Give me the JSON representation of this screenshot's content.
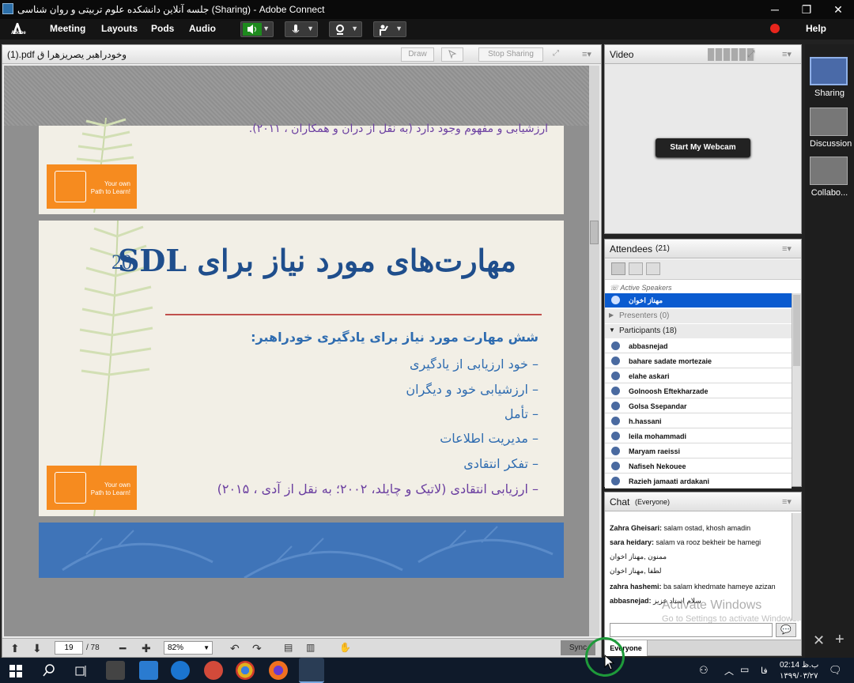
{
  "window": {
    "title": "جلسه آنلاین دانشکده علوم تربیتی و روان شناسی (Sharing) - Adobe Connect",
    "minimize": "─",
    "restore": "❐",
    "close": "✕"
  },
  "menubar": {
    "logo": "Adobe",
    "items": [
      "Meeting",
      "Layouts",
      "Pods",
      "Audio"
    ],
    "help": "Help"
  },
  "share_pod": {
    "filename": "(1).pdf وخودراهبر یصریزهرا ق",
    "draw": "Draw",
    "stop_sharing": "Stop Sharing"
  },
  "slide_top": {
    "text": "ارزشیابی و مفهوم وجود دارد (به نقل از دران و همکاران ، ۲۰۱۱).",
    "logo_line1": "Your own",
    "logo_line2": "Path to Learn!"
  },
  "slide_main": {
    "number": "20",
    "title": "مهارت‌های مورد نیاز برای SDL",
    "subtitle": "شش مهارت مورد نیاز برای یادگیری خودراهبر:",
    "bullets": [
      "– خود ارزیابی از یادگیری",
      "– ارزشیابی خود و دیگران",
      "– تأمل",
      "– مدیریت اطلاعات",
      "– تفکر انتقادی",
      "– ارزیابی انتقادی (لاتیک و چایلد، ۲۰۰۲؛ به نقل از آدی ، ۲۰۱۵)"
    ],
    "logo_line1": "Your own",
    "logo_line2": "Path to Learn!"
  },
  "doc_toolbar": {
    "page": "19",
    "total": "/ 78",
    "zoom": "82%",
    "sync": "Sync"
  },
  "video_pod": {
    "title": "Video",
    "button": "Start My Webcam"
  },
  "attendees_pod": {
    "title": "Attendees",
    "count": "(21)",
    "active_speakers_label": "Active Speakers",
    "active_speaker": "مهناز اخوان",
    "presenters": "Presenters (0)",
    "participants": "Participants (18)",
    "list": [
      "abbasnejad",
      "bahare sadate mortezaie",
      "elahe askari",
      "Golnoosh Eftekharzade",
      "Golsa Ssepandar",
      "h.hassani",
      "leila mohammadi",
      "Maryam raeissi",
      "Nafiseh Nekouee",
      "Razieh jamaati ardakani"
    ]
  },
  "chat_pod": {
    "title": "Chat",
    "scope": "(Everyone)",
    "messages": [
      {
        "who": "Zahra Gheisari:",
        "msg": " salam ostad, khosh amadin"
      },
      {
        "who": "sara heidary:",
        "msg": " salam va rooz bekheir be hamegi"
      },
      {
        "who": "",
        "msg": "ممنون ,مهناز اخوان"
      },
      {
        "who": "",
        "msg": "لطفا ,مهناز اخوان"
      },
      {
        "who": "zahra hashemi:",
        "msg": " ba salam khedmate hameye azizan"
      },
      {
        "who": "abbasnejad:",
        "msg": " سلام استاد عزیز"
      }
    ],
    "tab": "Everyone",
    "watermark_line1": "Activate Windows",
    "watermark_line2": "Go to Settings to activate Windows."
  },
  "layouts": [
    {
      "label": "Sharing"
    },
    {
      "label": "Discussion"
    },
    {
      "label": "Collabo..."
    }
  ],
  "taskbar": {
    "time": "02:14 ب.ظ",
    "date": "۱۳۹۹/۰۳/۲۷",
    "lang": "فا"
  },
  "colors": {
    "accent_blue": "#0a5bd0",
    "slide_title": "#1f4e8c",
    "logo_orange": "#f68b1f",
    "bullet_blue": "#2f6cb0",
    "rule_red": "#c0504d"
  }
}
